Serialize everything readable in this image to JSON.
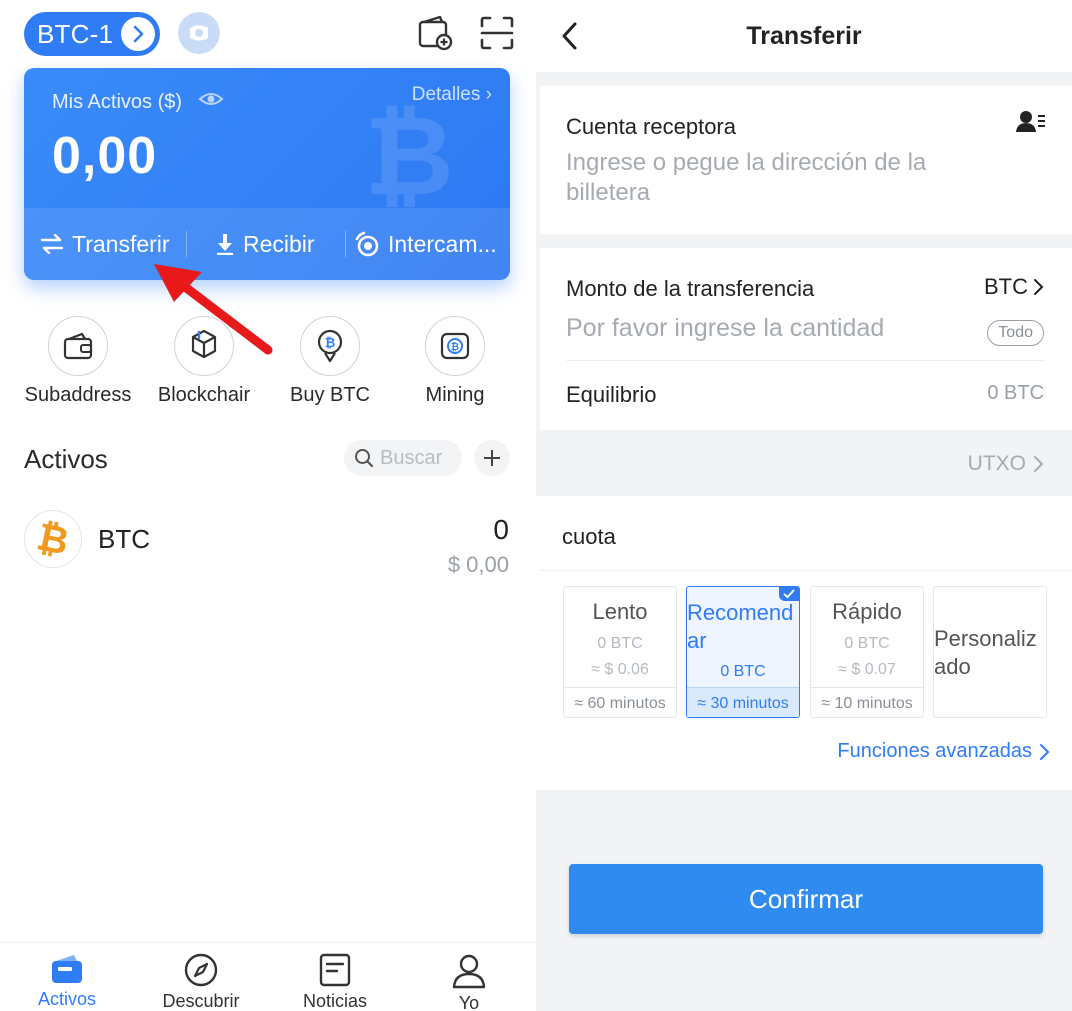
{
  "left": {
    "wallet_name": "BTC-1",
    "card": {
      "title": "Mis Activos ($)",
      "details_label": "Detalles",
      "balance": "0,00",
      "actions": [
        "Transferir",
        "Recibir",
        "Intercam..."
      ]
    },
    "quick_actions": [
      "Subaddress",
      "Blockchair",
      "Buy BTC",
      "Mining"
    ],
    "assets_title": "Activos",
    "search_placeholder": "Buscar",
    "assets": [
      {
        "symbol": "BTC",
        "amount": "0",
        "fiat": "$ 0,00"
      }
    ],
    "tabs": [
      "Activos",
      "Descubrir",
      "Noticias",
      "Yo"
    ],
    "active_tab": "Activos"
  },
  "right": {
    "title": "Transferir",
    "receiver_label": "Cuenta receptora",
    "receiver_placeholder": "Ingrese o pegue la dirección de la billetera",
    "amount_label": "Monto de la transferencia",
    "currency": "BTC",
    "amount_placeholder": "Por favor ingrese la cantidad",
    "all_label": "Todo",
    "balance_label": "Equilibrio",
    "balance_value": "0 BTC",
    "utxo_label": "UTXO",
    "fee_label": "cuota",
    "fees": [
      {
        "name": "Lento",
        "btc": "0 BTC",
        "usd": "≈ $ 0.06",
        "time": "≈ 60 minutos"
      },
      {
        "name": "Recomendar",
        "btc": "0 BTC",
        "usd": "",
        "time": "≈ 30 minutos"
      },
      {
        "name": "Rápido",
        "btc": "0 BTC",
        "usd": "≈ $ 0.07",
        "time": "≈ 10 minutos"
      },
      {
        "name": "Personalizado",
        "btc": "",
        "usd": "",
        "time": ""
      }
    ],
    "selected_fee": "Recomendar",
    "advanced_label": "Funciones avanzadas",
    "confirm_label": "Confirmar"
  },
  "colors": {
    "accent": "#2f7cf5",
    "annotation_arrow": "#e8191b",
    "bitcoin_orange": "#f39a1e"
  },
  "icons": [
    "chevron-right-icon",
    "wallet-add-icon",
    "scan-icon",
    "eye-icon",
    "transfer-icon",
    "download-icon",
    "exchange-icon",
    "wallet-icon",
    "cube-icon",
    "bitcoin-badge-icon",
    "mining-icon",
    "search-icon",
    "plus-icon",
    "bitcoin-icon",
    "compass-icon",
    "news-icon",
    "user-icon",
    "back-icon",
    "contact-icon",
    "check-icon"
  ]
}
